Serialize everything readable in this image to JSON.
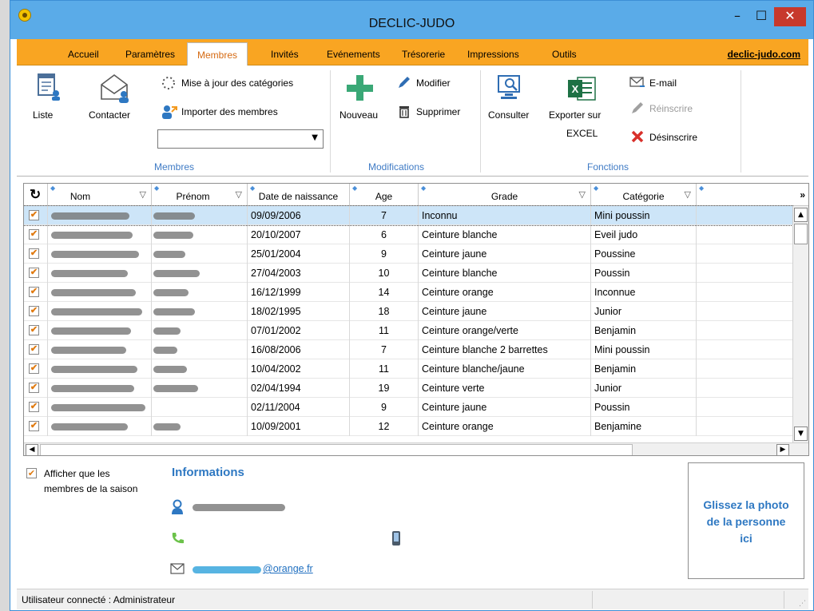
{
  "window": {
    "title": "DECLIC-JUDO",
    "minimize": "–",
    "maximize": "☐",
    "close": "✕"
  },
  "tabs": [
    "Accueil",
    "Paramètres",
    "Membres",
    "Invités",
    "Evénements",
    "Trésorerie",
    "Impressions",
    "Outils"
  ],
  "active_tab": "Membres",
  "site_link": "declic-judo.com",
  "ribbon": {
    "membres": {
      "liste": "Liste",
      "contacter": "Contacter",
      "maj_categories": "Mise à jour des catégories",
      "importer": "Importer des membres",
      "group": "Membres"
    },
    "modifications": {
      "nouveau": "Nouveau",
      "modifier": "Modifier",
      "supprimer": "Supprimer",
      "group": "Modifications"
    },
    "fonctions": {
      "consulter": "Consulter",
      "exporter_line1": "Exporter sur",
      "exporter_line2": "EXCEL",
      "email": "E-mail",
      "reinscrire": "Réinscrire",
      "desinscrire": "Désinscrire",
      "group": "Fonctions"
    }
  },
  "grid": {
    "headers": {
      "nom": "Nom",
      "prenom": "Prénom",
      "date": "Date de naissance",
      "age": "Age",
      "grade": "Grade",
      "categorie": "Catégorie",
      "more": "»"
    },
    "rows": [
      {
        "date": "09/09/2006",
        "age": "7",
        "grade": "Inconnu",
        "categorie": "Mini poussin"
      },
      {
        "date": "20/10/2007",
        "age": "6",
        "grade": "Ceinture blanche",
        "categorie": "Eveil judo"
      },
      {
        "date": "25/01/2004",
        "age": "9",
        "grade": "Ceinture jaune",
        "categorie": "Poussine"
      },
      {
        "date": "27/04/2003",
        "age": "10",
        "grade": "Ceinture blanche",
        "categorie": "Poussin"
      },
      {
        "date": "16/12/1999",
        "age": "14",
        "grade": "Ceinture orange",
        "categorie": "Inconnue"
      },
      {
        "date": "18/02/1995",
        "age": "18",
        "grade": "Ceinture jaune",
        "categorie": "Junior"
      },
      {
        "date": "07/01/2002",
        "age": "11",
        "grade": "Ceinture orange/verte",
        "categorie": "Benjamin"
      },
      {
        "date": "16/08/2006",
        "age": "7",
        "grade": "Ceinture blanche 2 barrettes",
        "categorie": "Mini poussin"
      },
      {
        "date": "10/04/2002",
        "age": "11",
        "grade": "Ceinture blanche/jaune",
        "categorie": "Benjamin"
      },
      {
        "date": "02/04/1994",
        "age": "19",
        "grade": "Ceinture verte",
        "categorie": "Junior"
      },
      {
        "date": "02/11/2004",
        "age": "9",
        "grade": "Ceinture jaune",
        "categorie": "Poussin"
      },
      {
        "date": "10/09/2001",
        "age": "12",
        "grade": "Ceinture orange",
        "categorie": "Benjamine"
      }
    ]
  },
  "bottom": {
    "checkbox_line1": "Afficher que les",
    "checkbox_line2": "membres de la saison",
    "informations": "Informations",
    "email_suffix": "@orange.fr",
    "photo_line1": "Glissez la photo",
    "photo_line2": "de la personne",
    "photo_line3": "ici"
  },
  "status": {
    "user": "Utilisateur connecté : Administrateur"
  },
  "colors": {
    "titlebar": "#5aabe8",
    "tabbar": "#f9a522",
    "accent_blue": "#2e78c2",
    "close_red": "#c7392c",
    "selection": "#cde5f8"
  }
}
